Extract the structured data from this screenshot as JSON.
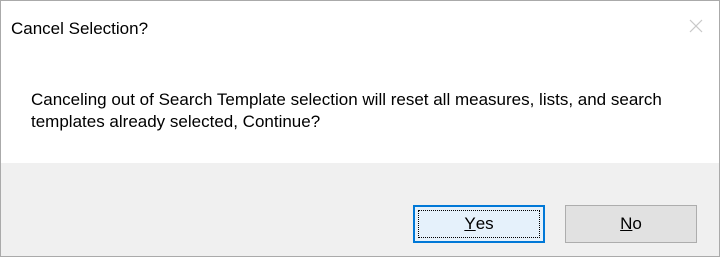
{
  "dialog": {
    "title": "Cancel Selection?",
    "message": "Canceling out of Search Template selection will reset all measures, lists, and search templates already selected, Continue?",
    "close_icon": "close-icon"
  },
  "buttons": {
    "yes": {
      "mnemonic": "Y",
      "rest": "es"
    },
    "no": {
      "mnemonic": "N",
      "rest": "o"
    }
  },
  "colors": {
    "focus_border": "#0078d7",
    "footer_bg": "#f0f0f0",
    "button_bg": "#e1e1e1"
  }
}
